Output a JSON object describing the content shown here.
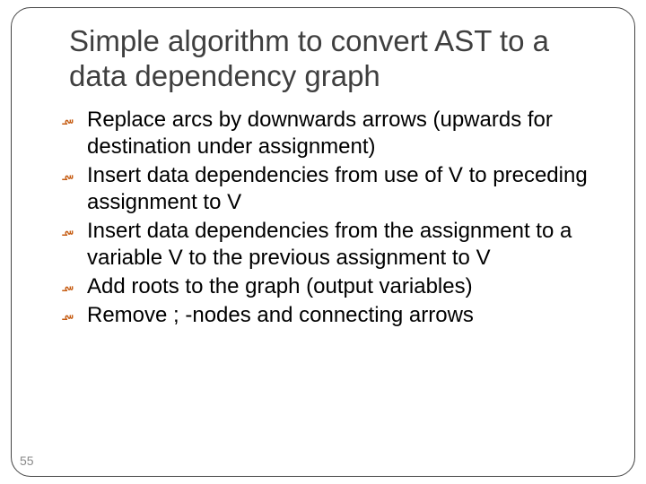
{
  "title": "Simple algorithm to convert AST to a data dependency graph",
  "bullets": [
    "Replace arcs by downwards arrows (upwards for destination under assignment)",
    "Insert data dependencies from use of V to preceding assignment to V",
    "Insert data dependencies from the assignment to a variable V to the previous assignment to V",
    "Add roots to the graph (output variables)",
    "Remove ; -nodes and connecting arrows"
  ],
  "page_number": "55",
  "bullet_glyph": "؄"
}
